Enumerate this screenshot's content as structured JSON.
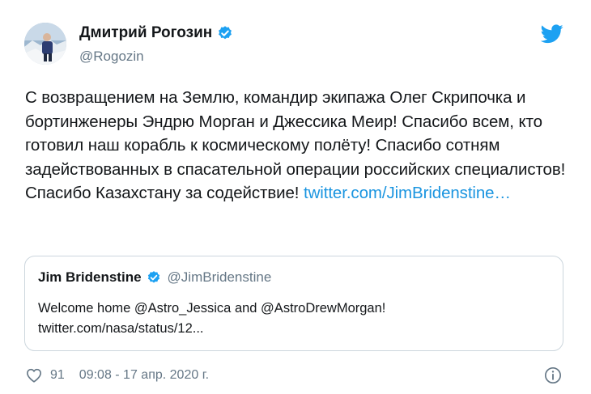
{
  "author": {
    "display_name": "Дмитрий Рогозин",
    "handle": "@Rogozin",
    "verified": true
  },
  "icons": {
    "platform": "twitter-bird-icon",
    "verified": "verified-badge-icon",
    "like": "heart-icon",
    "info": "info-icon"
  },
  "colors": {
    "link": "#1b95e0",
    "verified": "#1da1f2",
    "muted": "#657786",
    "border": "#ccd6dd"
  },
  "tweet": {
    "text": "С возвращением на Землю, командир экипажа Олег Скрипочка и бортинженеры Эндрю Морган и Джессика Меир! Спасибо всем, кто готовил наш корабль к космическому полёту! Спасибо сотням задействованных в спасательной операции российских специалистов! Спасибо Казахстану за содействие! ",
    "link_text": "twitter.com/JimBridenstine…"
  },
  "quoted_tweet": {
    "display_name": "Jim Bridenstine",
    "handle": "@JimBridenstine",
    "verified": true,
    "line1": "Welcome home @Astro_Jessica and @AstroDrewMorgan!",
    "line2": "twitter.com/nasa/status/12..."
  },
  "footer": {
    "likes": "91",
    "timestamp": "09:08 - 17 апр. 2020 г."
  }
}
